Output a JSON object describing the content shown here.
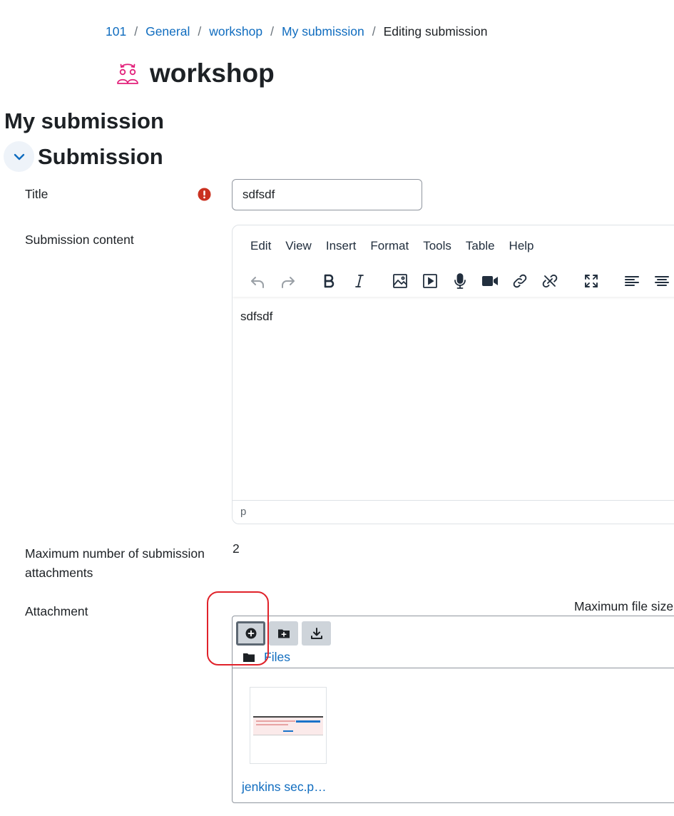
{
  "breadcrumb": {
    "items": [
      {
        "label": "101"
      },
      {
        "label": "General"
      },
      {
        "label": "workshop"
      },
      {
        "label": "My submission"
      }
    ],
    "separator": "/",
    "current": "Editing submission"
  },
  "activity": {
    "title": "workshop",
    "icon": "workshop-icon",
    "icon_color": "#e2207a"
  },
  "page": {
    "heading": "My submission",
    "section_heading": "Submission"
  },
  "form": {
    "title_label": "Title",
    "title_value": "sdfsdf",
    "content_label": "Submission content",
    "max_attachments_label_line1": "Maximum number of submission",
    "max_attachments_label_line2": "attachments",
    "max_attachments_value": "2",
    "attachment_label": "Attachment",
    "max_file_size_label": "Maximum file size"
  },
  "editor": {
    "menu": [
      "Edit",
      "View",
      "Insert",
      "Format",
      "Tools",
      "Table",
      "Help"
    ],
    "toolbar_icons": [
      "undo-icon",
      "redo-icon",
      "bold-icon",
      "italic-icon",
      "image-icon",
      "media-icon",
      "microphone-icon",
      "video-camera-icon",
      "link-icon",
      "unlink-icon",
      "fullscreen-icon",
      "align-left-icon",
      "align-center-icon"
    ],
    "content": "sdfsdf",
    "status_path": "p"
  },
  "filemanager": {
    "buttons": [
      "add-file-icon",
      "create-folder-icon",
      "download-icon"
    ],
    "path_label": "Files",
    "files": [
      {
        "name": "jenkins sec.p…"
      }
    ]
  },
  "colors": {
    "link": "#0f6cbf",
    "text": "#1d2125",
    "required": "#ca3120",
    "annotation": "#e0222a"
  }
}
